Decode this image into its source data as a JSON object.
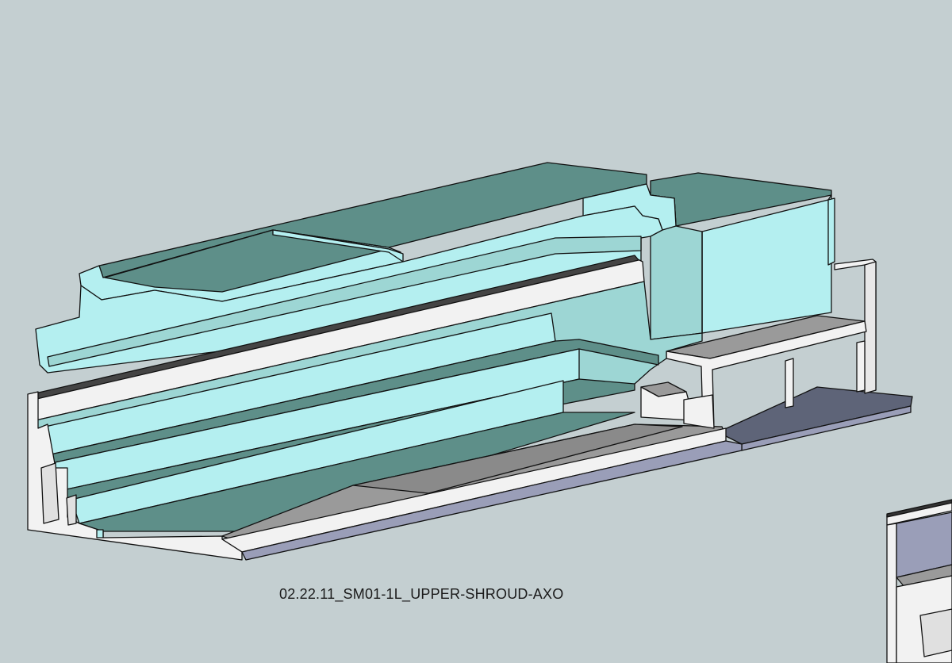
{
  "drawing": {
    "caption": "02.22.11_SM01-1L_UPPER-SHROUD-AXO"
  },
  "colors": {
    "background": "#c4cfd1",
    "cyan_light": "#b4eff0",
    "cyan_mid": "#9dd6d4",
    "teal_dark": "#5e8f89",
    "white_face": "#f2f2f2",
    "gray_floor": "#9a9a9a",
    "blue_gray": "#9a9eb8",
    "slate": "#5e6478",
    "outline": "#111111"
  }
}
